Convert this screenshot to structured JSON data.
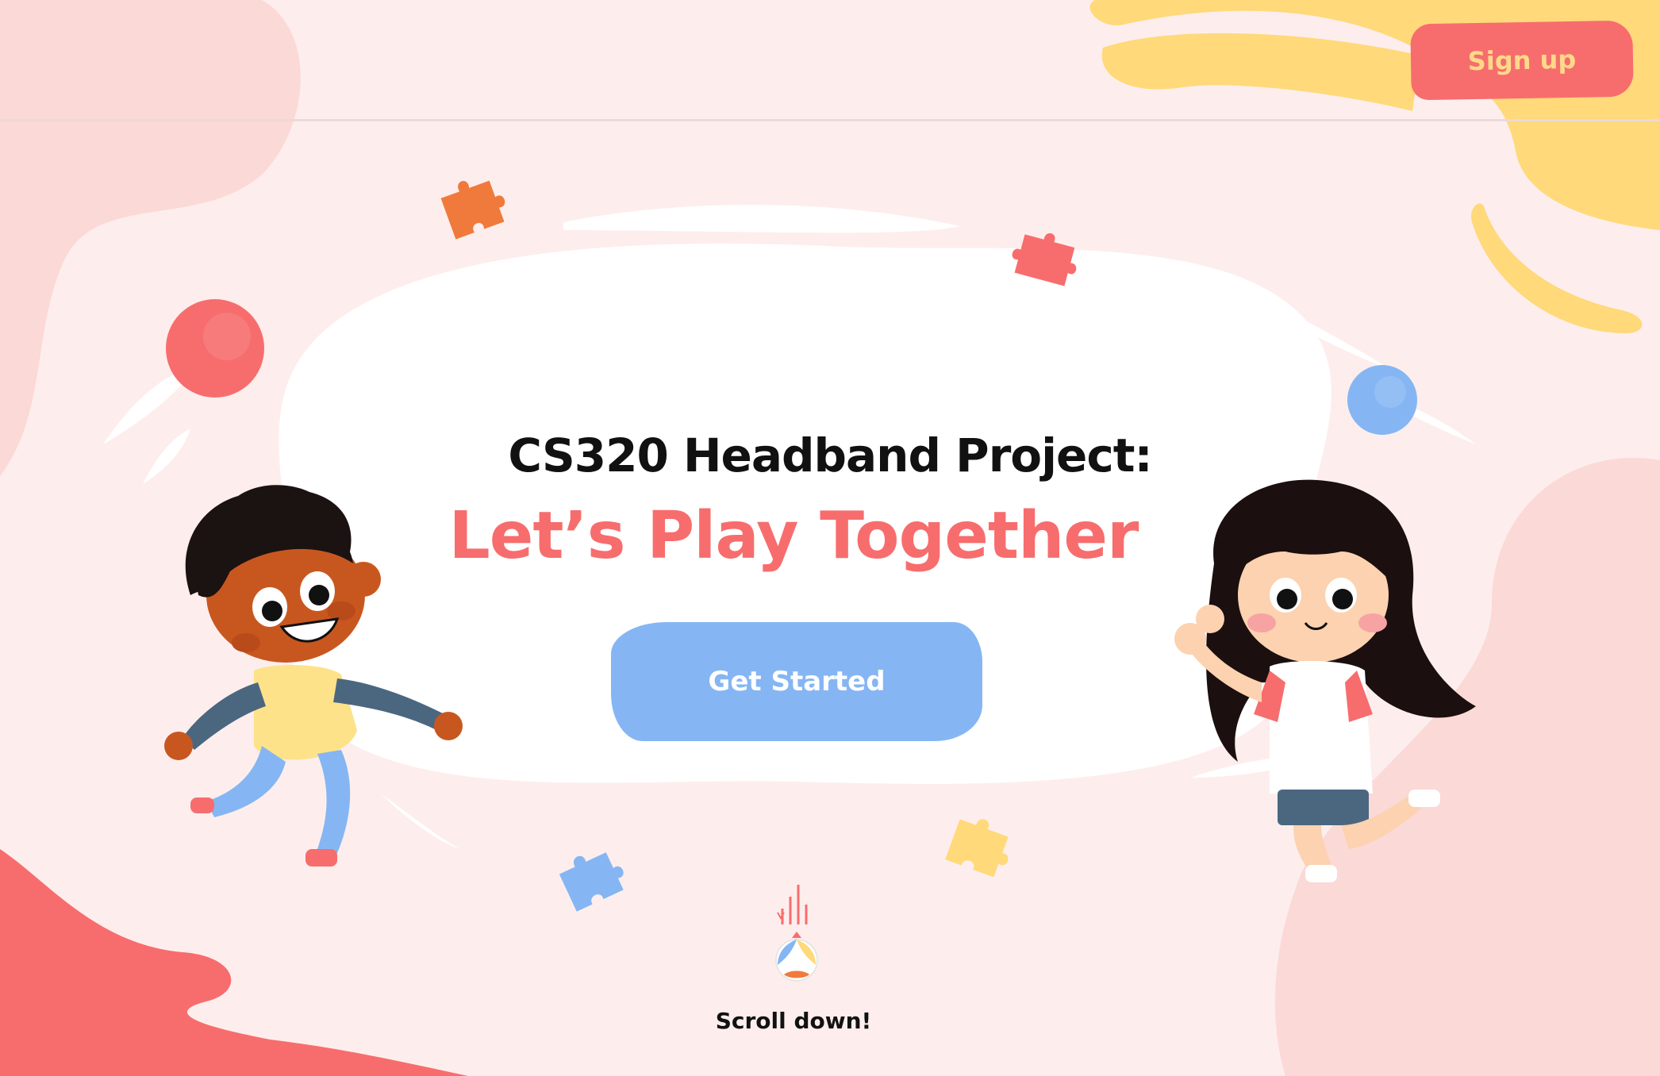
{
  "header": {
    "signup_label": "Sign up"
  },
  "hero": {
    "title": "CS320 Headband Project:",
    "subtitle": "Let’s Play Together",
    "cta_label": "Get Started"
  },
  "scroll": {
    "label": "Scroll down!"
  },
  "icons": [
    "puzzle-piece-icon",
    "ball-icon",
    "beach-ball-icon"
  ],
  "colors": {
    "background": "#fdeeed",
    "accent_red": "#f76d6d",
    "accent_yellow": "#ffd97a",
    "accent_blue": "#85b6f3",
    "puzzle_orange": "#f07a3c"
  }
}
